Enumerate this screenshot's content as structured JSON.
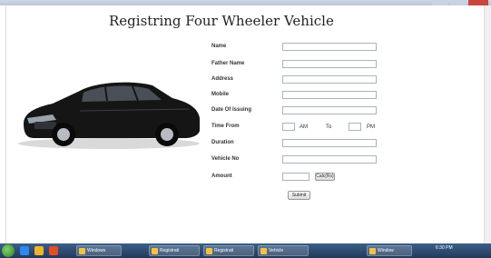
{
  "header": {
    "title": "Registring Four Wheeler Vehicle"
  },
  "form": {
    "fields": [
      {
        "label": "Name"
      },
      {
        "label": "Father Name"
      },
      {
        "label": "Address"
      },
      {
        "label": "Mobile"
      },
      {
        "label": "Date Of Issuing"
      },
      {
        "label": "Time From"
      },
      {
        "label": "Duration"
      },
      {
        "label": "Vehicle No"
      },
      {
        "label": "Amount"
      }
    ],
    "time_am": "AM",
    "time_to": "To",
    "time_pm": "PM",
    "calc_button": "Calc(Rs)",
    "submit_button": "Submit"
  },
  "taskbar": {
    "items": [
      "Windows",
      "Registrati",
      "Registrati",
      "Vehicle",
      "Window"
    ],
    "clock": "6:30 PM"
  },
  "colors": {
    "titlebar": "#b9c6da",
    "close": "#c9463d",
    "taskbar": "#21395a"
  }
}
